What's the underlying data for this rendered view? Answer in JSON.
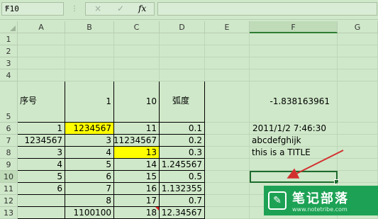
{
  "formula_bar": {
    "name_box": "F10",
    "cancel_icon": "×",
    "enter_icon": "✓",
    "fx_label": "fx",
    "formula_value": ""
  },
  "columns": [
    "A",
    "B",
    "C",
    "D",
    "E",
    "F",
    "G"
  ],
  "rows": [
    "1",
    "2",
    "3",
    "4",
    "5",
    "6",
    "7",
    "8",
    "9",
    "10",
    "11",
    "12",
    "13"
  ],
  "cells": {
    "A5": "序号",
    "B5": "1",
    "C5": "10",
    "D5": "弧度",
    "F5": "-1.838163961",
    "A6": "1",
    "B6": "1234567",
    "C6": "11",
    "D6": "0.1",
    "F6": "2011/1/2 7:46:30",
    "A7": "1234567",
    "B7": "3",
    "C7": "11234567",
    "D7": "0.2",
    "F7": "abcdefghijk",
    "A8": "3",
    "B8": "4",
    "C8": "13",
    "D8": "0.3",
    "F8": "this is a TITLE",
    "A9": "4",
    "B9": "5",
    "C9": "14",
    "D9": "1.245567",
    "A10": "5",
    "B10": "6",
    "C10": "15",
    "D10": "0.5",
    "A11": "6",
    "B11": "7",
    "C11": "16",
    "D11": "1.132355",
    "B12": "8",
    "C12": "17",
    "D12": "0.7",
    "B13": "1100100",
    "C13": "18",
    "D13": "12.34567"
  },
  "selected_cell": "F10",
  "highlight_color": "#ffff00",
  "watermark": {
    "title": "笔记部落",
    "url": "www.notetribe.com"
  }
}
